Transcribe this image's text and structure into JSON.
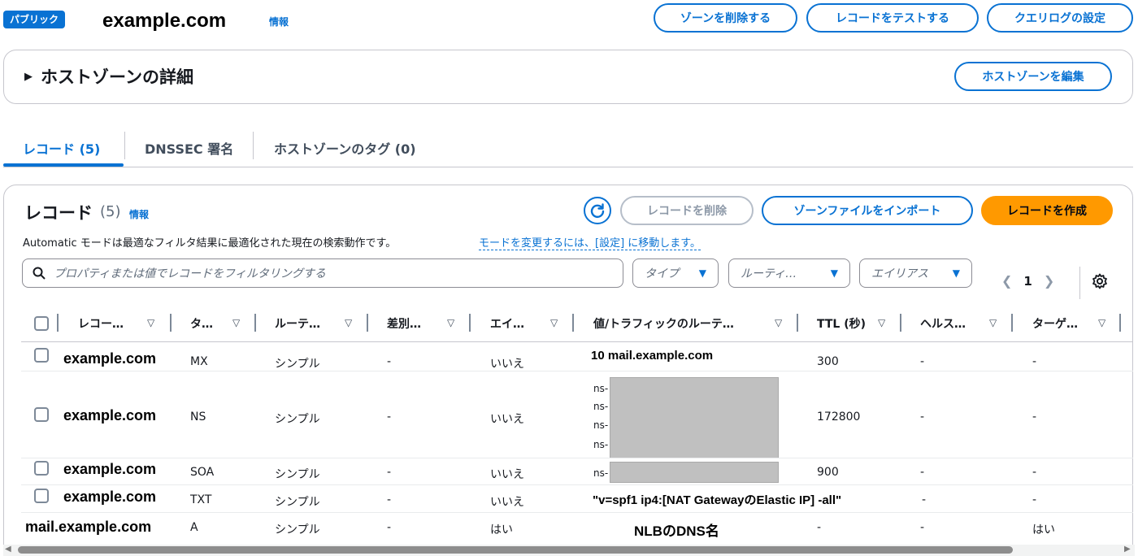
{
  "header": {
    "badge": "パブリック",
    "zone_name": "example.com",
    "info": "情報",
    "buttons": {
      "delete_zone": "ゾーンを削除する",
      "test_record": "レコードをテストする",
      "query_log": "クエリログの設定"
    }
  },
  "details": {
    "title": "ホストゾーンの詳細",
    "edit_button": "ホストゾーンを編集"
  },
  "tabs": [
    {
      "label": "レコード (5)"
    },
    {
      "label": "DNSSEC 署名"
    },
    {
      "label": "ホストゾーンのタグ (0)"
    }
  ],
  "records_panel": {
    "title": "レコード",
    "count": "(5)",
    "info": "情報",
    "description": "Automatic モードは最適なフィルタ結果に最適化された現在の検索動作です。",
    "description_link": "モードを変更するには、[設定] に移動します。",
    "buttons": {
      "delete": "レコードを削除",
      "import": "ゾーンファイルをインポート",
      "create": "レコードを作成"
    },
    "search_placeholder": "プロパティまたは値でレコードをフィルタリングする",
    "filters": {
      "type": "タイプ",
      "routing": "ルーティ…",
      "alias": "エイリアス"
    },
    "page": "1"
  },
  "table": {
    "columns": [
      "レコー…",
      "タ…",
      "ルーテ…",
      "差別…",
      "エイ…",
      "値/トラフィックのルーテ…",
      "TTL (秒)",
      "ヘルス…",
      "ターゲ…"
    ],
    "rows": [
      {
        "name": "example.com",
        "type": "MX",
        "routing": "シンプル",
        "diff": "-",
        "alias": "いいえ",
        "value": "10 mail.example.com",
        "ttl": "300",
        "health": "-",
        "target": "-"
      },
      {
        "name": "example.com",
        "type": "NS",
        "routing": "シンプル",
        "diff": "-",
        "alias": "いいえ",
        "value_lines": [
          "ns-",
          "ns-",
          "ns-",
          "ns-"
        ],
        "ttl": "172800",
        "health": "-",
        "target": "-"
      },
      {
        "name": "example.com",
        "type": "SOA",
        "routing": "シンプル",
        "diff": "-",
        "alias": "いいえ",
        "value": "ns-",
        "ttl": "900",
        "health": "-",
        "target": "-"
      },
      {
        "name": "example.com",
        "type": "TXT",
        "routing": "シンプル",
        "diff": "-",
        "alias": "いいえ",
        "value": "\"v=spf1 ip4:[NAT GatewayのElastic IP] -all\"",
        "ttl": "-",
        "health": "",
        "target": "-"
      },
      {
        "name": "mail.example.com",
        "type": "A",
        "routing": "シンプル",
        "diff": "-",
        "alias": "はい",
        "value": "NLBのDNS名",
        "ttl": "-",
        "health": "-",
        "target": "はい"
      }
    ]
  },
  "colors": {
    "accent": "#0972d3",
    "primary_button": "#ff9900"
  },
  "icons": [
    "refresh-icon",
    "search-icon",
    "caret-down-icon",
    "gear-icon",
    "chevron-left-icon",
    "chevron-right-icon"
  ]
}
